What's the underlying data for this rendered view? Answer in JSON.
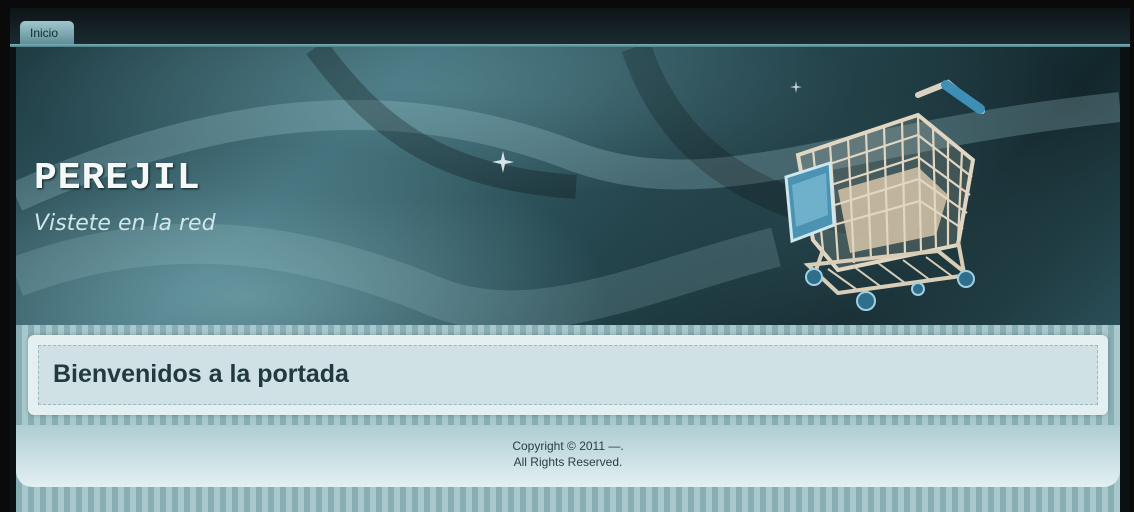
{
  "nav": {
    "tabs": [
      {
        "label": "Inicio"
      }
    ]
  },
  "header": {
    "site_title": "PEREJIL",
    "tagline": "Vistete en la red",
    "illustration_icon": "shopping-cart-icon"
  },
  "main": {
    "heading": "Bienvenidos a la portada"
  },
  "footer": {
    "copyright": "Copyright © 2011 —.",
    "rights": "All Rights Reserved."
  },
  "colors": {
    "banner_dark": "#1f3b42",
    "banner_light": "#3d6a74",
    "stripe_dark": "#88aeb4",
    "stripe_light": "#a9c8cd",
    "content_bg": "#cfe1e4",
    "heading_text": "#213a40"
  }
}
